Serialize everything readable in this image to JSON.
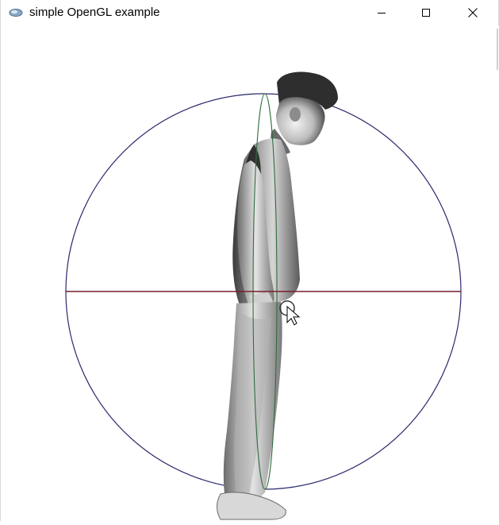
{
  "window": {
    "title": "simple OpenGL example",
    "controls": {
      "minimize": "minimize-icon",
      "maximize": "maximize-icon",
      "close": "close-icon"
    }
  },
  "scene": {
    "trackball_circle_color": "#2b2a6b",
    "horizontal_axis_color": "#7a1f2a",
    "vertical_ellipse_color": "#2f6b3a",
    "model": "standing-human-figure",
    "cursor": "arrow-cursor-icon"
  }
}
